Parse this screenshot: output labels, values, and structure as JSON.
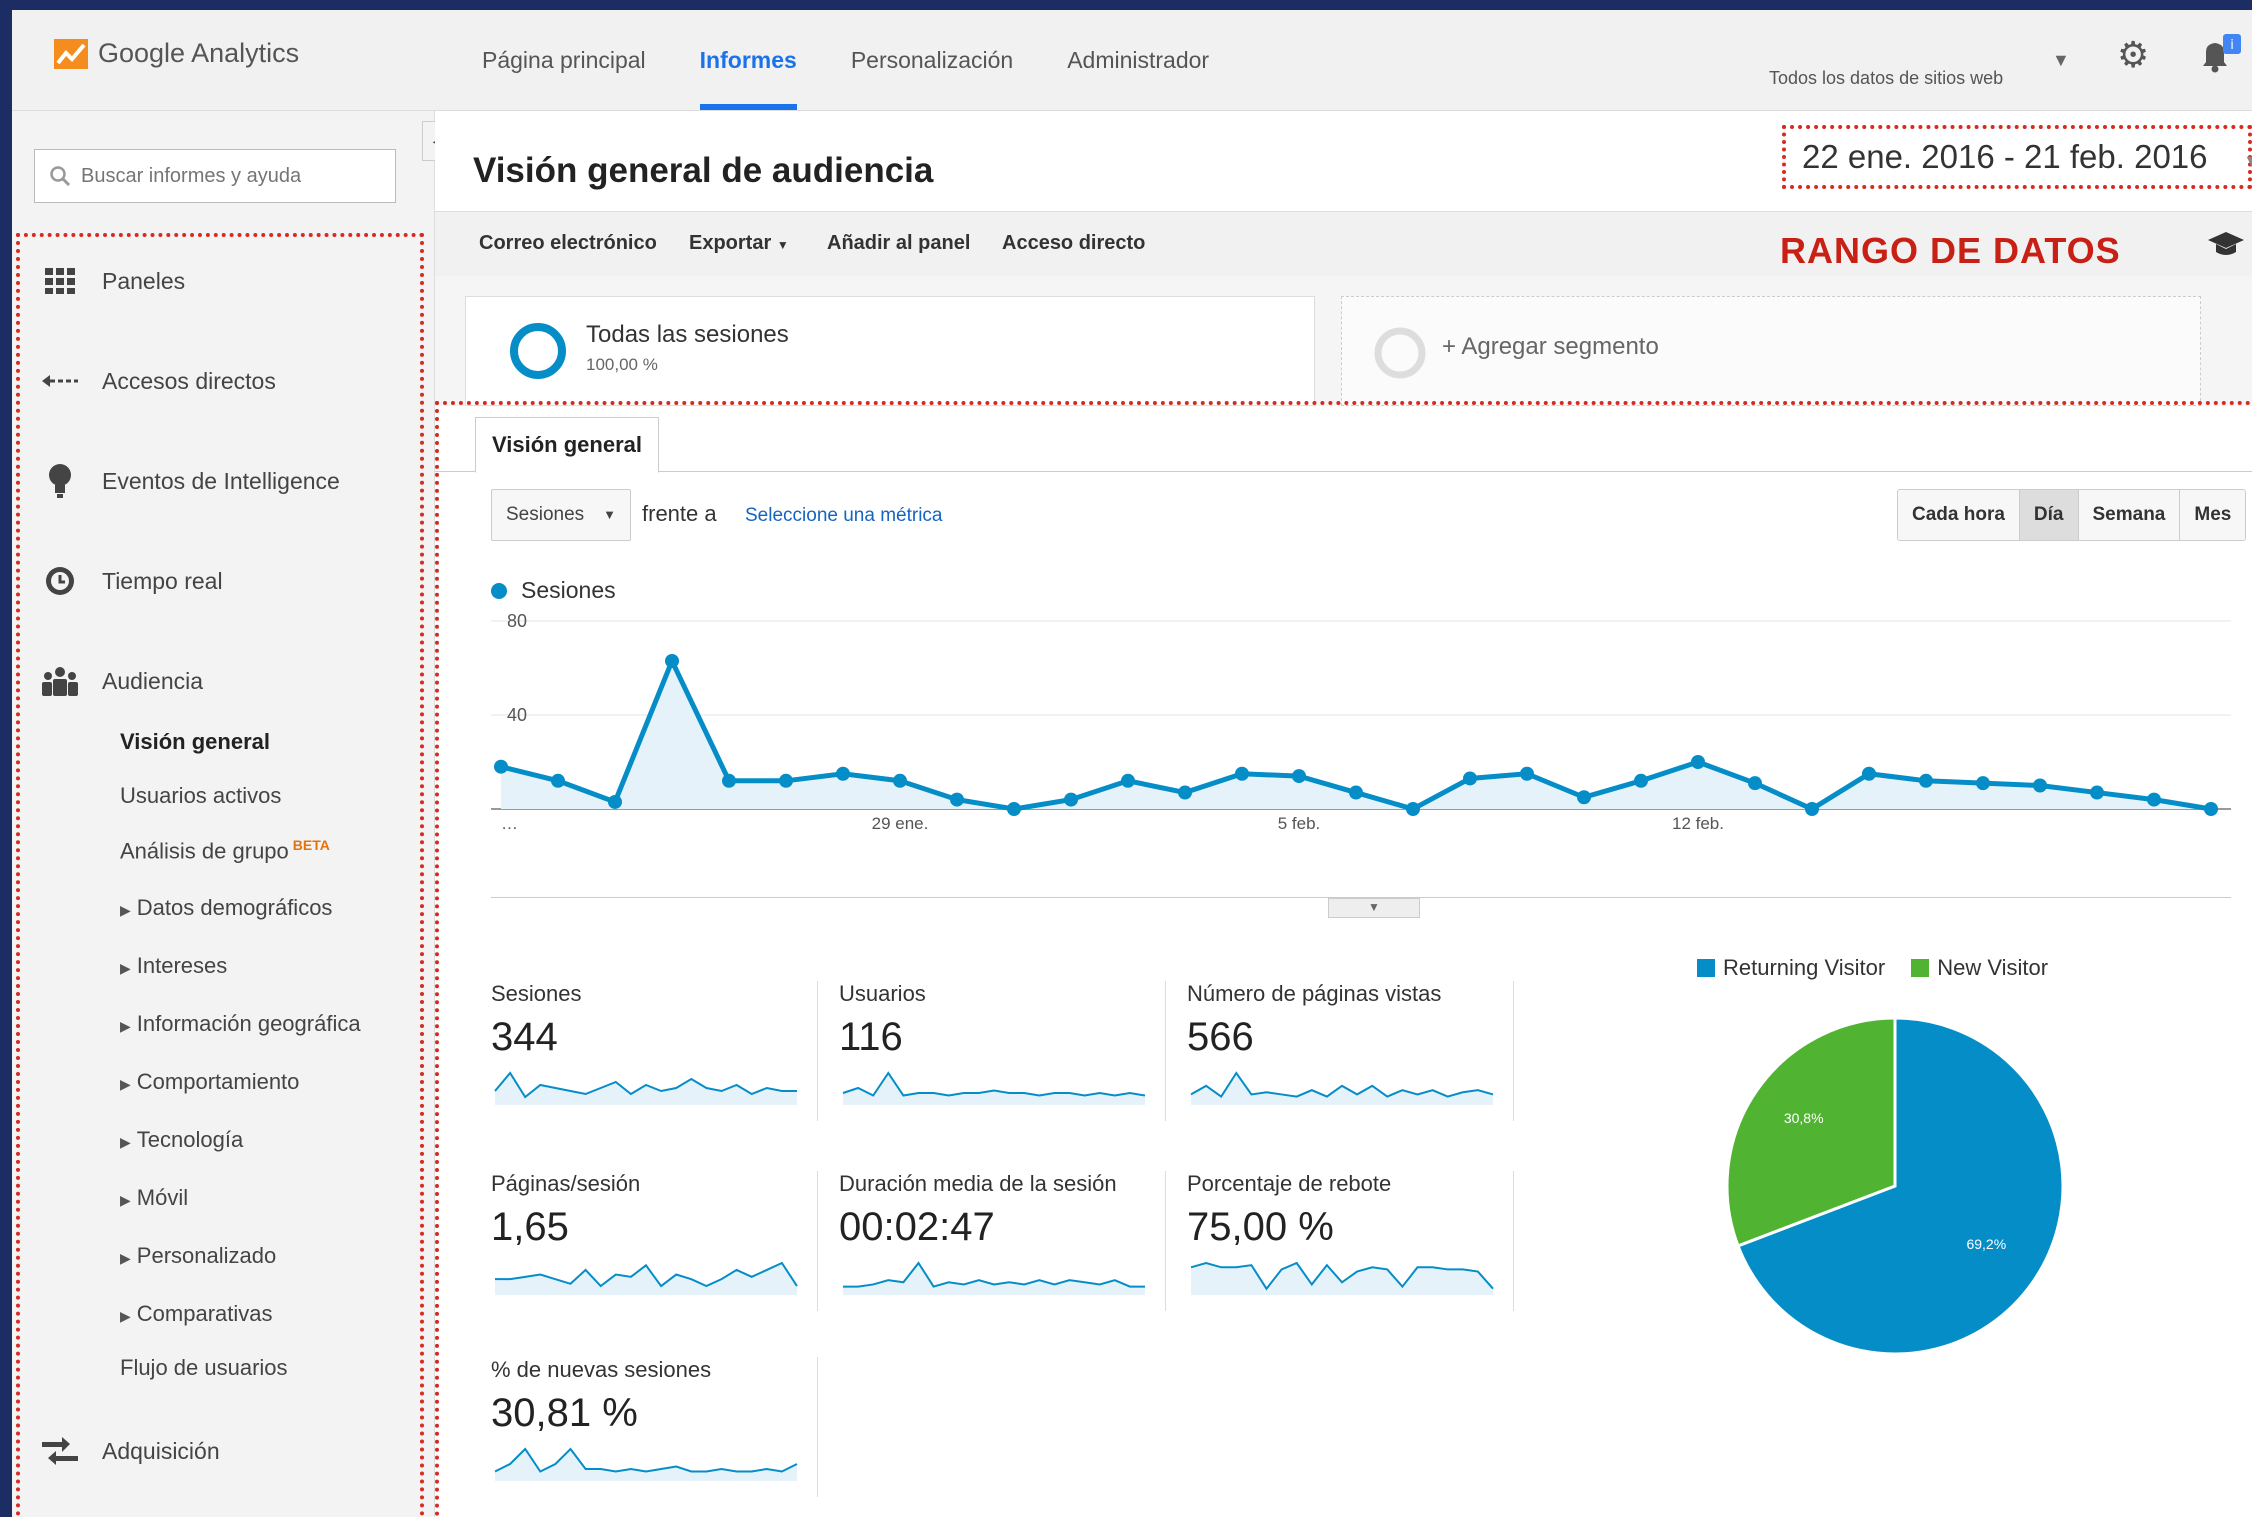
{
  "app": {
    "logo_text": "Google Analytics",
    "nav": [
      "Página principal",
      "Informes",
      "Personalización",
      "Administrador"
    ],
    "active_nav_index": 1,
    "account": "Todos los datos de sitios web",
    "notification_badge": "i"
  },
  "sidebar": {
    "search_placeholder": "Buscar informes y ayuda",
    "items": [
      {
        "label": "Paneles",
        "icon": "grid-icon"
      },
      {
        "label": "Accesos directos",
        "icon": "shortcut-arrow-icon"
      },
      {
        "label": "Eventos de Intelligence",
        "icon": "lightbulb-icon"
      },
      {
        "label": "Tiempo real",
        "icon": "clock-icon"
      },
      {
        "label": "Audiencia",
        "icon": "people-icon"
      },
      {
        "label": "Adquisición",
        "icon": "acquisition-arrows-icon"
      }
    ],
    "audience_sub": [
      {
        "label": "Visión general",
        "active": true
      },
      {
        "label": "Usuarios activos"
      },
      {
        "label": "Análisis de grupo",
        "badge": "BETA"
      },
      {
        "label": "Datos demográficos",
        "expandable": true
      },
      {
        "label": "Intereses",
        "expandable": true
      },
      {
        "label": "Información geográfica",
        "expandable": true
      },
      {
        "label": "Comportamiento",
        "expandable": true
      },
      {
        "label": "Tecnología",
        "expandable": true
      },
      {
        "label": "Móvil",
        "expandable": true
      },
      {
        "label": "Personalizado",
        "expandable": true
      },
      {
        "label": "Comparativas",
        "expandable": true
      },
      {
        "label": "Flujo de usuarios"
      }
    ]
  },
  "main": {
    "title": "Visión general de audiencia",
    "date_range": "22 ene. 2016 - 21 feb. 2016",
    "toolbar": [
      "Correo electrónico",
      "Exportar",
      "Añadir al panel",
      "Acceso directo"
    ],
    "annotation": "RANGO DE DATOS",
    "segment": {
      "title": "Todas las sesiones",
      "pct": "100,00 %"
    },
    "add_segment": "+ Agregar segmento",
    "tab": "Visión general",
    "metric_select": "Sesiones",
    "frente": "frente a",
    "select_metric": "Seleccione una métrica",
    "granularity": [
      "Cada hora",
      "Día",
      "Semana",
      "Mes"
    ],
    "granularity_active": 1
  },
  "chart_data": [
    {
      "type": "area",
      "series": [
        {
          "name": "Sesiones",
          "color": "#058dc7",
          "values": [
            18,
            12,
            3,
            63,
            12,
            12,
            15,
            12,
            4,
            0,
            4,
            12,
            7,
            15,
            14,
            7,
            0,
            13,
            15,
            5,
            12,
            20,
            11,
            0,
            15,
            12,
            11,
            10,
            7,
            4,
            0
          ]
        }
      ],
      "ylim": [
        0,
        80
      ],
      "yticks": [
        "80",
        "40"
      ],
      "xticks": [
        {
          "label": "…",
          "index": 0
        },
        {
          "label": "29 ene.",
          "index": 7
        },
        {
          "label": "5 feb.",
          "index": 14
        },
        {
          "label": "12 feb.",
          "index": 21
        }
      ]
    },
    {
      "type": "pie",
      "slices": [
        {
          "name": "Returning Visitor",
          "value": 69.2,
          "label": "69,2%",
          "color": "#058dc7"
        },
        {
          "name": "New Visitor",
          "value": 30.8,
          "label": "30,8%",
          "color": "#50b432"
        }
      ]
    }
  ],
  "metrics": [
    {
      "label": "Sesiones",
      "value": "344",
      "spark": [
        4,
        10,
        2,
        6,
        5,
        4,
        3,
        5,
        7,
        3,
        6,
        4,
        5,
        8,
        5,
        4,
        6,
        3,
        5,
        4,
        4
      ]
    },
    {
      "label": "Usuarios",
      "value": "116",
      "spark": [
        4,
        6,
        3,
        12,
        3,
        4,
        4,
        3,
        4,
        4,
        5,
        4,
        4,
        3,
        4,
        4,
        3,
        4,
        3,
        4,
        3
      ]
    },
    {
      "label": "Número de páginas vistas",
      "value": "566",
      "spark": [
        4,
        8,
        3,
        14,
        4,
        5,
        4,
        3,
        6,
        3,
        8,
        4,
        8,
        3,
        6,
        4,
        6,
        3,
        5,
        6,
        4
      ]
    },
    {
      "label": "Páginas/sesión",
      "value": "1,65",
      "spark": [
        6,
        6,
        7,
        8,
        6,
        4,
        10,
        3,
        8,
        7,
        12,
        3,
        8,
        6,
        3,
        6,
        10,
        7,
        10,
        13,
        3
      ]
    },
    {
      "label": "Duración media de la sesión",
      "value": "00:02:47",
      "spark": [
        3,
        3,
        4,
        6,
        5,
        14,
        3,
        5,
        4,
        6,
        4,
        5,
        4,
        6,
        4,
        6,
        5,
        4,
        6,
        3,
        3
      ]
    },
    {
      "label": "Porcentaje de rebote",
      "value": "75,00 %",
      "spark": [
        12,
        14,
        12,
        12,
        13,
        2,
        11,
        14,
        4,
        13,
        5,
        10,
        12,
        11,
        3,
        12,
        12,
        11,
        11,
        10,
        2
      ]
    },
    {
      "label": "% de nuevas sesiones",
      "value": "30,81 %",
      "spark": [
        3,
        6,
        12,
        3,
        6,
        12,
        4,
        4,
        3,
        4,
        3,
        4,
        5,
        3,
        3,
        4,
        3,
        3,
        4,
        3,
        6
      ]
    }
  ]
}
